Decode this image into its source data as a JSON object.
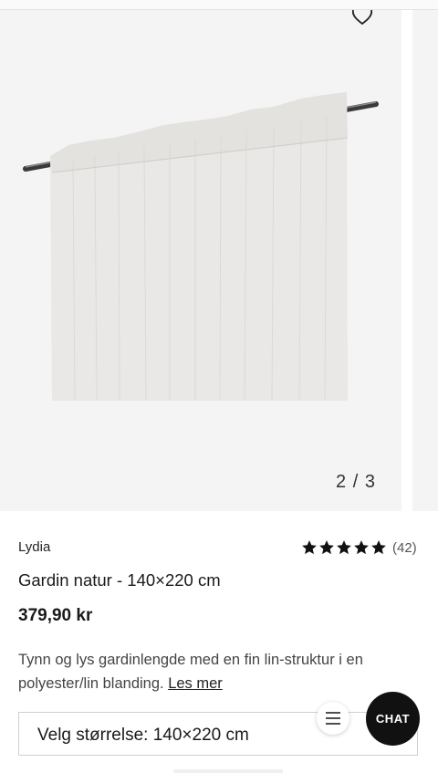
{
  "gallery": {
    "counter": "2 / 3",
    "image_alt": "Gardin natur hanging on curtain rod"
  },
  "product": {
    "brand": "Lydia",
    "rating": {
      "stars": 5,
      "count_label": "(42)"
    },
    "title": "Gardin natur - 140×220 cm",
    "price": "379,90 kr",
    "description": "Tynn og lys gardinlengde med en fin lin-struktur i en polyester/lin blanding.",
    "read_more": "Les mer"
  },
  "size_select": {
    "label": "Velg størrelse: 140×220 cm"
  },
  "floating": {
    "chat_label": "CHAT"
  },
  "icons": {
    "wishlist": "heart-icon",
    "menu": "menu-icon",
    "star": "star-icon"
  },
  "colors": {
    "chat_bg": "#111111",
    "image_bg": "#f4f4f4",
    "star": "#111111"
  }
}
